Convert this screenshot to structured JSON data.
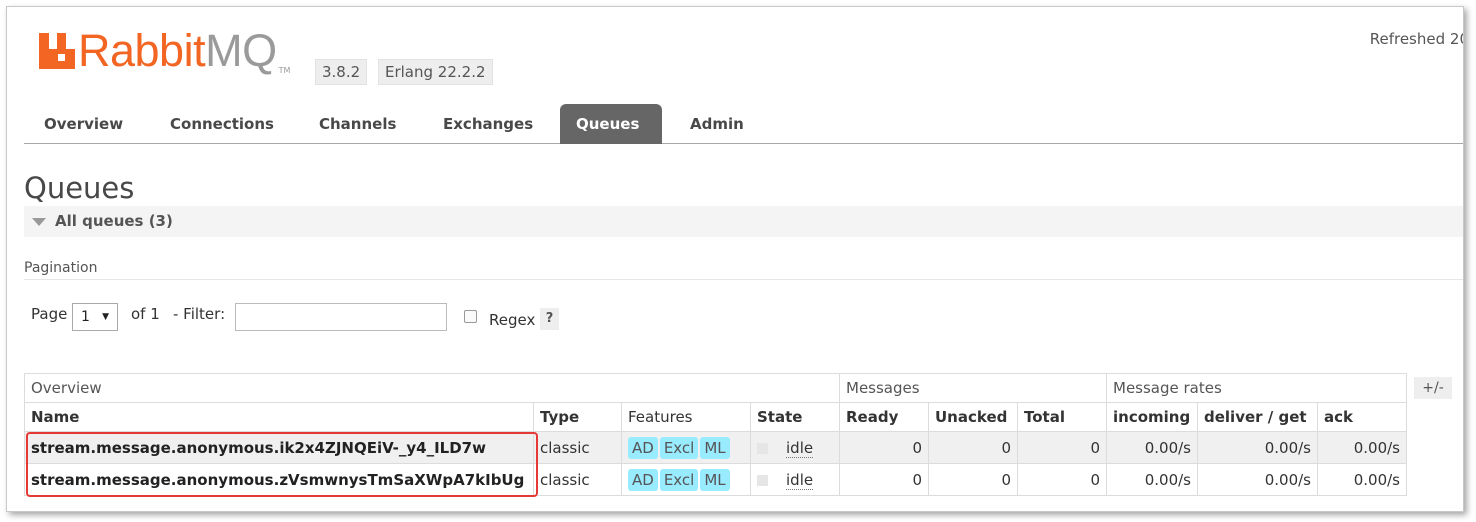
{
  "app": {
    "logo_brand": "Rabbit",
    "logo_brand_suffix": "MQ",
    "logo_tm": "TM",
    "version": "3.8.2",
    "erlang": "Erlang 22.2.2",
    "refreshed": "Refreshed 20"
  },
  "tabs": [
    {
      "label": "Overview"
    },
    {
      "label": "Connections"
    },
    {
      "label": "Channels"
    },
    {
      "label": "Exchanges"
    },
    {
      "label": "Queues"
    },
    {
      "label": "Admin"
    }
  ],
  "active_tab": "Queues",
  "page": {
    "title": "Queues",
    "section": "All queues (3)",
    "pagination_label": "Pagination"
  },
  "pagination": {
    "page_label": "Page",
    "page_value": "1",
    "of_label": "of 1",
    "filter_label": "- Filter:",
    "filter_value": "",
    "regex_label": "Regex",
    "help": "?"
  },
  "table": {
    "groups": [
      "Overview",
      "Messages",
      "Message rates"
    ],
    "toggle": "+/-",
    "columns": [
      "Name",
      "Type",
      "Features",
      "State",
      "Ready",
      "Unacked",
      "Total",
      "incoming",
      "deliver / get",
      "ack"
    ],
    "rows": [
      {
        "name": "stream.message.anonymous.ik2x4ZJNQEiV-_y4_ILD7w",
        "type": "classic",
        "features": [
          "AD",
          "Excl",
          "ML"
        ],
        "state": "idle",
        "ready": "0",
        "unacked": "0",
        "total": "0",
        "incoming": "0.00/s",
        "deliver_get": "0.00/s",
        "ack": "0.00/s"
      },
      {
        "name": "stream.message.anonymous.zVsmwnysTmSaXWpA7kIbUg",
        "type": "classic",
        "features": [
          "AD",
          "Excl",
          "ML"
        ],
        "state": "idle",
        "ready": "0",
        "unacked": "0",
        "total": "0",
        "incoming": "0.00/s",
        "deliver_get": "0.00/s",
        "ack": "0.00/s"
      }
    ]
  },
  "colors": {
    "brand_orange": "#f26522",
    "active_tab": "#666666",
    "feature_badge": "#99ebff",
    "highlight_box": "#e53935"
  }
}
